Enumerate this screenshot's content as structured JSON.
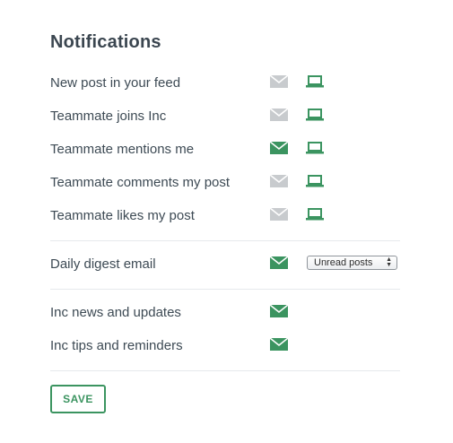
{
  "title": "Notifications",
  "colors": {
    "active": "#3b9460",
    "inactive": "#c8cbce",
    "text": "#3d4a54"
  },
  "rows": [
    {
      "label": "New post in your feed",
      "email": "email-off-icon",
      "device": "device-on-icon"
    },
    {
      "label": "Teammate joins Inc",
      "email": "email-off-icon",
      "device": "device-on-icon"
    },
    {
      "label": "Teammate mentions me",
      "email": "email-on-icon",
      "device": "device-on-icon"
    },
    {
      "label": "Teammate comments my post",
      "email": "email-off-icon",
      "device": "device-on-icon"
    },
    {
      "label": "Teammate likes my post",
      "email": "email-off-icon",
      "device": "device-on-icon"
    }
  ],
  "digest": {
    "label": "Daily digest email",
    "email": "email-on-icon",
    "select_value": "Unread posts",
    "select_arrows": "▲▼"
  },
  "company_rows": [
    {
      "label": "Inc news and updates",
      "email": "email-on-icon"
    },
    {
      "label": "Inc tips and reminders",
      "email": "email-on-icon"
    }
  ],
  "save_label": "SAVE"
}
